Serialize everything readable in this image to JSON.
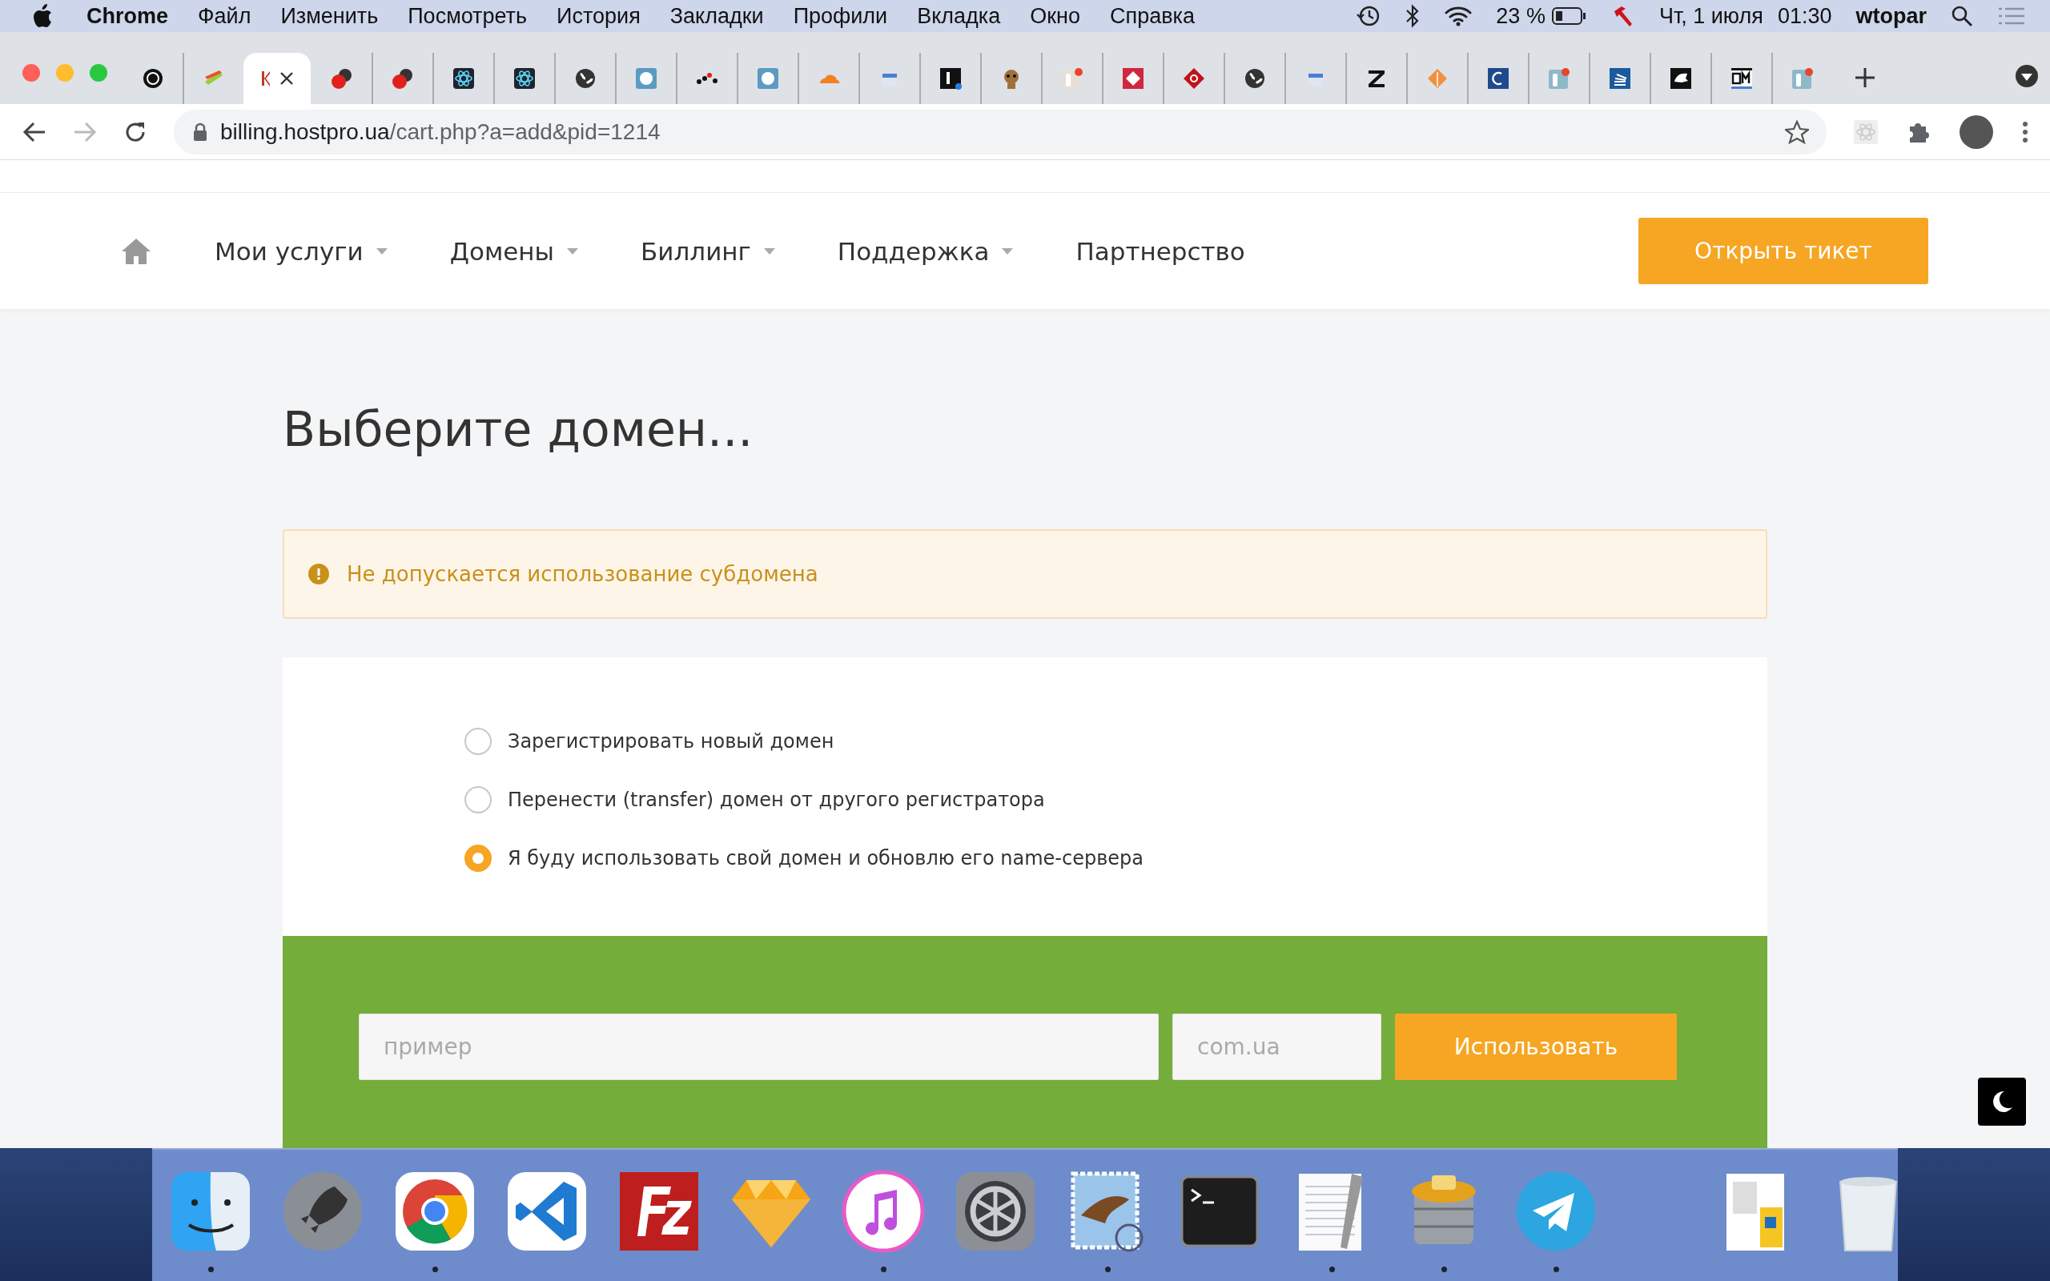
{
  "menu_bar": {
    "app": "Chrome",
    "menus": [
      "Файл",
      "Изменить",
      "Посмотреть",
      "История",
      "Закладки",
      "Профили",
      "Вкладка",
      "Окно",
      "Справка"
    ],
    "battery": "23 %",
    "date": "Чт, 1 июля",
    "time": "01:30",
    "user": "wtopar"
  },
  "tabs": [
    {
      "selected": false
    },
    {
      "selected": false
    },
    {
      "selected": true
    },
    {
      "selected": false
    },
    {
      "selected": false
    },
    {
      "selected": false
    },
    {
      "selected": false
    },
    {
      "selected": false
    },
    {
      "selected": false
    },
    {
      "selected": false
    },
    {
      "selected": false
    },
    {
      "selected": false
    },
    {
      "selected": false
    },
    {
      "selected": false
    },
    {
      "selected": false
    },
    {
      "selected": false
    },
    {
      "selected": false
    },
    {
      "selected": false
    },
    {
      "selected": false
    },
    {
      "selected": false
    },
    {
      "selected": false
    },
    {
      "selected": false
    },
    {
      "selected": false
    },
    {
      "selected": false
    },
    {
      "selected": false
    },
    {
      "selected": false
    },
    {
      "selected": false
    },
    {
      "selected": false
    }
  ],
  "address_bar": {
    "host": "billing.hostpro.ua",
    "path": "/cart.php?a=add&pid=1214"
  },
  "nav": {
    "items": [
      {
        "label": "Мои услуги",
        "dropdown": true
      },
      {
        "label": "Домены",
        "dropdown": true
      },
      {
        "label": "Биллинг",
        "dropdown": true
      },
      {
        "label": "Поддержка",
        "dropdown": true
      },
      {
        "label": "Партнерство",
        "dropdown": false
      }
    ],
    "button": "Открыть тикет"
  },
  "page": {
    "title": "Выберите домен...",
    "alert": "Не допускается использование субдомена",
    "options": [
      {
        "label": "Зарегистрировать новый домен",
        "selected": false
      },
      {
        "label": "Перенести (transfer) домен от другого регистратора",
        "selected": false
      },
      {
        "label": "Я буду использовать свой домен и обновлю его name-сервера",
        "selected": true
      }
    ],
    "domain_field": {
      "placeholder": "пример"
    },
    "tld_field": {
      "placeholder": "com.ua"
    },
    "submit": "Использовать"
  },
  "dock": {
    "items": [
      {
        "kind": "finder",
        "running": true
      },
      {
        "kind": "rocket",
        "running": false
      },
      {
        "kind": "browser",
        "running": true
      },
      {
        "kind": "editor",
        "running": false
      },
      {
        "kind": "ftp",
        "running": false
      },
      {
        "kind": "gem",
        "running": false
      },
      {
        "kind": "music",
        "running": true
      },
      {
        "kind": "gear",
        "running": false
      },
      {
        "kind": "stamp",
        "running": true
      },
      {
        "kind": "terminal",
        "running": false
      },
      {
        "kind": "notepad",
        "running": true
      },
      {
        "kind": "database",
        "running": true
      },
      {
        "kind": "plane",
        "running": true
      },
      {
        "kind": "separator"
      },
      {
        "kind": "document",
        "running": false
      },
      {
        "kind": "trash",
        "running": false
      }
    ]
  }
}
